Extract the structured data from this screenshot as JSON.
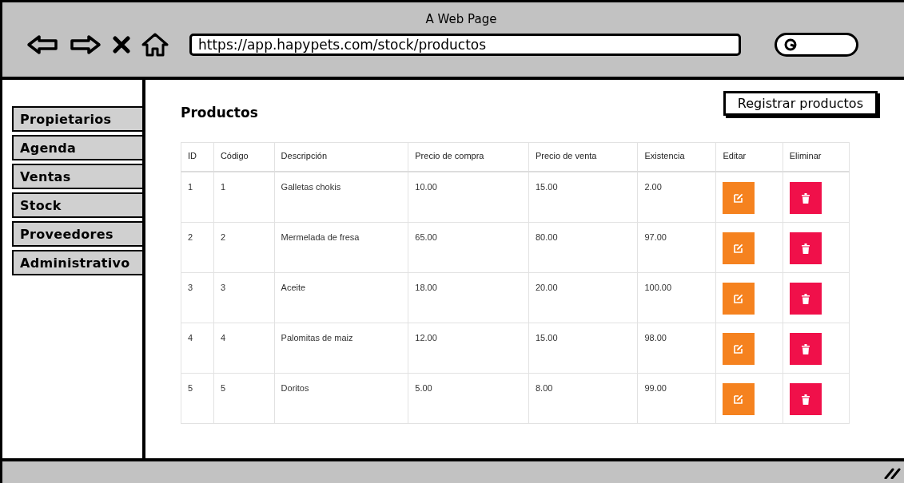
{
  "window": {
    "title": "A Web Page"
  },
  "address_bar": {
    "value": "https://app.hapypets.com/stock/productos"
  },
  "sidebar": {
    "items": [
      "Propietarios",
      "Agenda",
      "Ventas",
      "Stock",
      "Proveedores",
      "Administrativo"
    ]
  },
  "page": {
    "title": "Productos",
    "register_button": "Registrar productos"
  },
  "table": {
    "columns": [
      "ID",
      "Código",
      "Descripción",
      "Precio de compra",
      "Precio de venta",
      "Existencia",
      "Editar",
      "Eliminar"
    ],
    "rows": [
      [
        "1",
        "1",
        "Galletas chokis",
        "10.00",
        "15.00",
        "2.00"
      ],
      [
        "2",
        "2",
        "Mermelada de fresa",
        "65.00",
        "80.00",
        "97.00"
      ],
      [
        "3",
        "3",
        "Aceite",
        "18.00",
        "20.00",
        "100.00"
      ],
      [
        "4",
        "4",
        "Palomitas de maiz",
        "12.00",
        "15.00",
        "98.00"
      ],
      [
        "5",
        "5",
        "Doritos",
        "5.00",
        "8.00",
        "99.00"
      ]
    ]
  }
}
